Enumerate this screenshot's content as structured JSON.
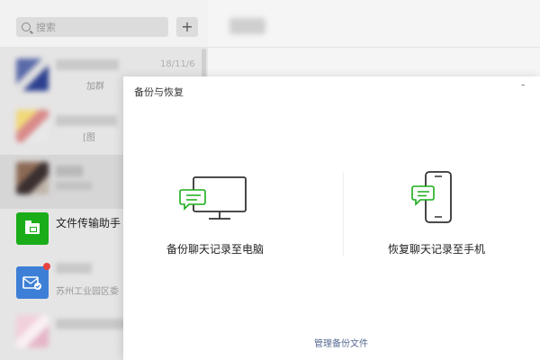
{
  "sidebar": {
    "search": {
      "placeholder": "搜索"
    },
    "add_label": "+",
    "chats": [
      {
        "time": "18/11/6",
        "subtitle": "加群"
      },
      {
        "subtitle": "[图"
      },
      {
        "subtitle": ""
      },
      {
        "name": "文件传输助手",
        "subtitle": ""
      },
      {
        "subtitle": "苏州工业园区委"
      },
      {
        "subtitle": ""
      }
    ]
  },
  "dialog": {
    "title": "备份与恢复",
    "minimize": "-",
    "backup_label": "备份聊天记录至电脑",
    "restore_label": "恢复聊天记录至手机",
    "manage_link": "管理备份文件"
  },
  "colors": {
    "accent_green": "#1aad19",
    "link_blue": "#576b95",
    "mail_blue": "#3d7fd6",
    "badge_red": "#e64340"
  }
}
